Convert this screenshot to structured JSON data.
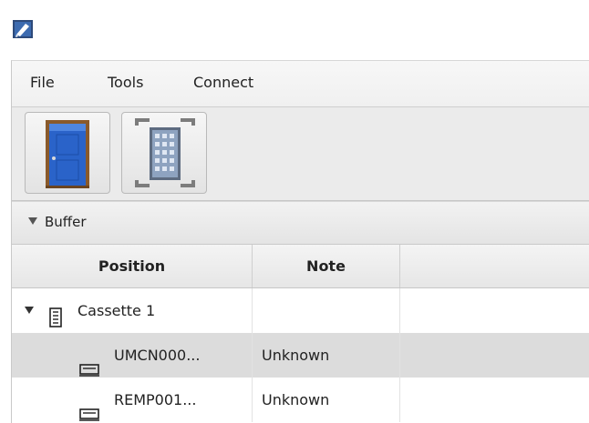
{
  "app": {
    "icon": "pen-app-icon"
  },
  "menu": {
    "items": [
      "File",
      "Tools",
      "Connect"
    ]
  },
  "toolbar": {
    "buttons": [
      {
        "icon": "door-icon",
        "accent": "#2a63c9"
      },
      {
        "icon": "building-grid-icon",
        "accent": "#6f7f95"
      }
    ]
  },
  "pane": {
    "title": "Buffer",
    "expanded": true
  },
  "table": {
    "columns": [
      "Position",
      "Note",
      ""
    ],
    "rows": [
      {
        "position": "Cassette 1",
        "note": "",
        "type": "cassette",
        "icon": "cassette-icon",
        "expanded": true,
        "selected": false
      },
      {
        "position": "UMCN000...",
        "note": "Unknown",
        "type": "wafer",
        "icon": "wafer-tray-icon",
        "selected": true
      },
      {
        "position": "REMP001...",
        "note": "Unknown",
        "type": "wafer",
        "icon": "wafer-tray-icon",
        "selected": false
      }
    ]
  },
  "colors": {
    "selected_row": "#dcdcdc",
    "header_bg": "#e6e6e6"
  }
}
